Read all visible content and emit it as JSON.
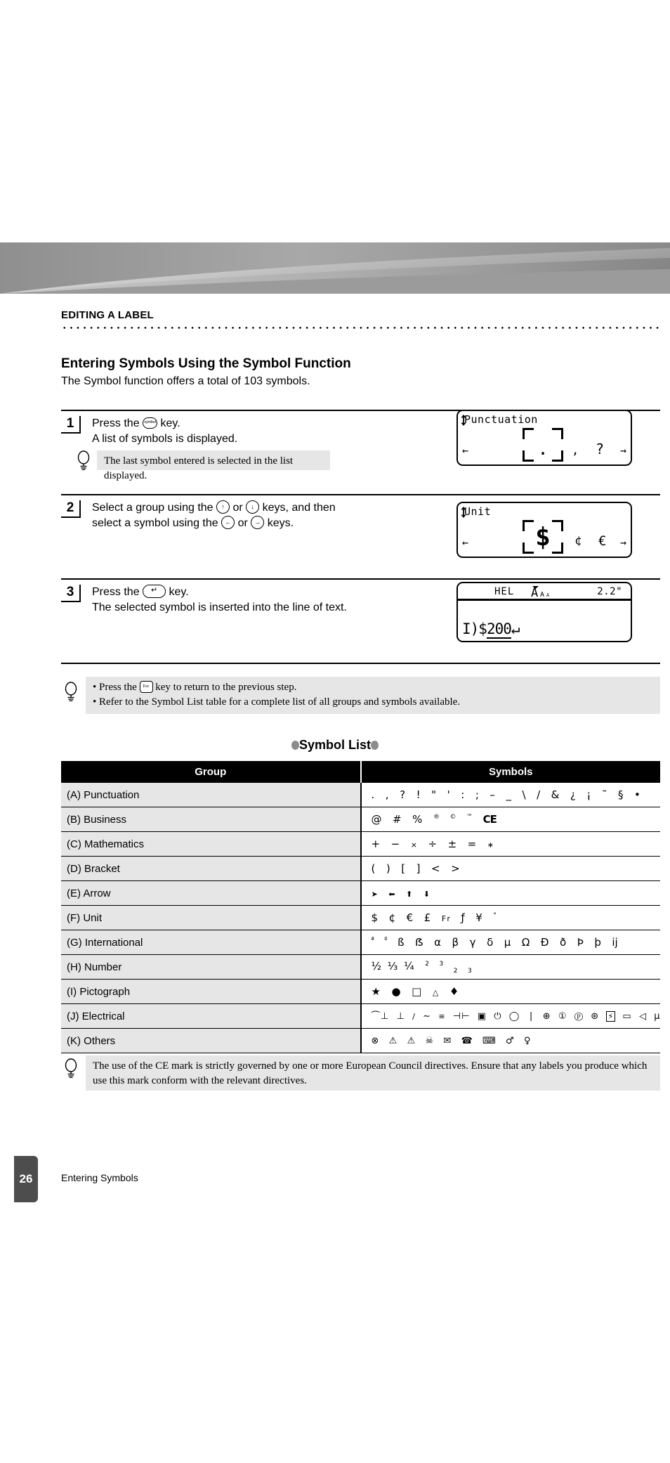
{
  "header": {
    "section": "EDITING A LABEL",
    "title": "Entering Symbols Using the Symbol Function",
    "subtitle": "The Symbol function offers a total of 103 symbols."
  },
  "steps": [
    {
      "number": "1",
      "line1_before_key": "Press the",
      "key_label": "symbol",
      "line1_after_key": "key.",
      "line2": "A list of symbols is displayed."
    },
    {
      "number": "2",
      "line1_before_key": "Select a group using the",
      "key1": "↑",
      "mid": "or",
      "key2": "↓",
      "line1_after_key": "keys, and then",
      "line2_before_key": "select a symbol using the",
      "key3": "←",
      "mid2": "or",
      "key4": "→",
      "line2_after_key": "keys."
    },
    {
      "number": "3",
      "line1_before_key": "Press the",
      "key_label": "↵",
      "line1_after_key": "key.",
      "line2": "The selected symbol is inserted into the line of text."
    }
  ],
  "tips": {
    "step1_note": "The last symbol entered is selected in the list displayed.",
    "bullets": [
      {
        "before_key": "Press the",
        "key_label": "Esc",
        "after_key": "key to return to the previous step."
      },
      {
        "text": "Refer to the Symbol List table for a complete list of all groups and symbols available."
      }
    ],
    "ce_note": "The use of the CE mark is strictly governed by one or more European Council directives. Ensure that any labels you produce which use this mark conform with the relevant directives."
  },
  "lcds": [
    {
      "title": "Punctuation",
      "selected": ".",
      "right_symbols": [
        ",",
        "?"
      ],
      "left_arrow": "←",
      "right_arrow": "→"
    },
    {
      "title": "Unit",
      "selected": "$",
      "right_symbols": [
        "¢",
        "€"
      ],
      "left_arrow": "←",
      "right_arrow": "→"
    },
    {
      "status_left": "HEL",
      "status_font_icon": "A",
      "status_right": "2.2\"",
      "body_prefix": "І)",
      "body_symbol": "$",
      "body_text": "200",
      "body_return": "↵"
    }
  ],
  "symbol_list": {
    "title": "Symbol List",
    "columns": [
      "Group",
      "Symbols"
    ],
    "rows": [
      {
        "group": "(A) Punctuation",
        "symbols": ".  ,  ?  !  \"  '  :  ;  –  _  \\  /  &  ¿  ¡  ~  §  •"
      },
      {
        "group": "(B) Business",
        "symbols": "@  #  %"
      },
      {
        "group": "(C) Mathematics",
        "symbols": "+  −  ×  ÷  ±  =  ∗"
      },
      {
        "group": "(D) Bracket",
        "symbols": "(  )  [  ]  <  >"
      },
      {
        "group": "(E) Arrow",
        "symbols": "➔  ←  ↑  ↓"
      },
      {
        "group": "(F) Unit",
        "symbols": "$  ¢  €  £  Fr  ƒ  ¥  °"
      },
      {
        "group": "(G) International",
        "symbols": "ß  ẞ  α  β  γ  δ  µ  Ω  Ð  ð  Þ  þ  ĳ"
      },
      {
        "group": "(H) Number",
        "symbols": "½  ⅓  ¼"
      },
      {
        "group": "(I) Pictograph",
        "symbols": "★  ●  □  △  ♦"
      },
      {
        "group": "(J) Electrical",
        "symbols": "⏚  ⏦  ⫼  ∼  ═  ⊣⊢  ▣  ⏻  ◯  ❘  ⊕  ①  ⓧ  ⊛  ⚡  ▭  ◁  µ  Ω"
      },
      {
        "group": "(K) Others",
        "symbols": "⊗  ⚠  ⚠  ☠  ☎  ☏  ⌨  ♂  ♀"
      }
    ]
  },
  "footer": {
    "page_number": "26",
    "label": "Entering Symbols"
  }
}
